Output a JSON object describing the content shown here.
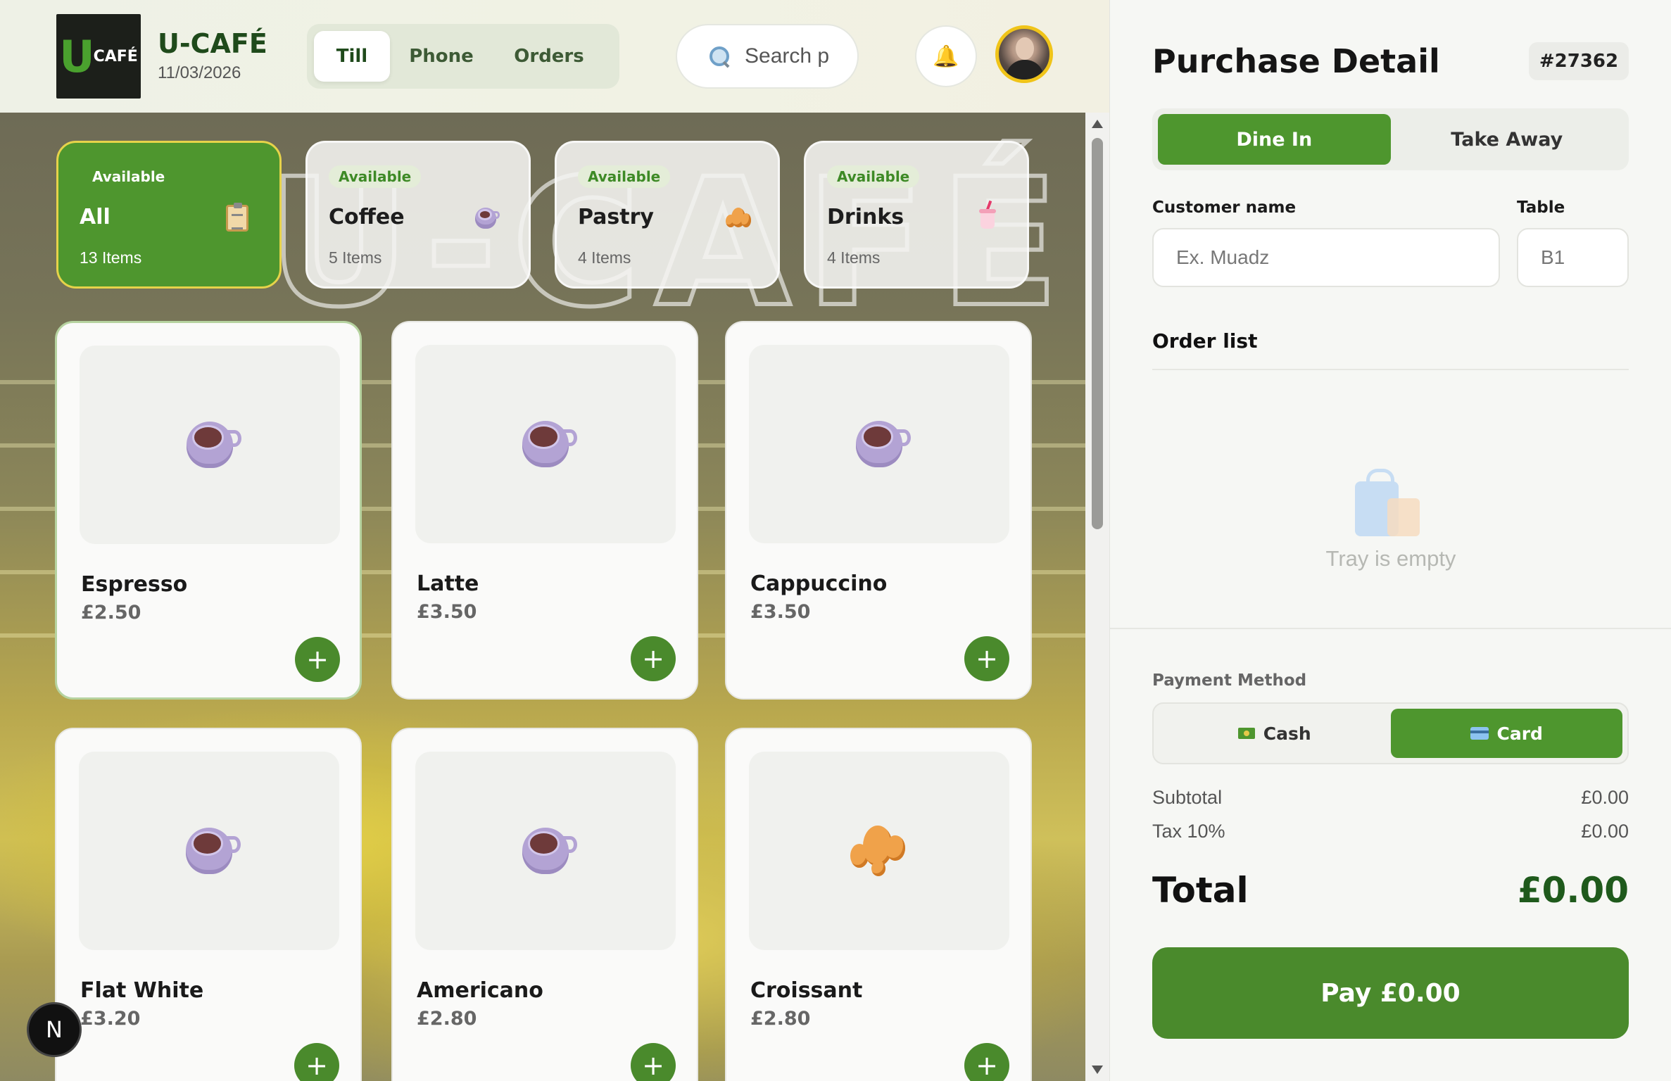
{
  "brand": {
    "logo_text_u": "U",
    "logo_text_cafe": "CAFÉ",
    "name": "U-CAFÉ",
    "date": "11/03/2026"
  },
  "nav": {
    "tabs": [
      {
        "label": "Till",
        "active": true
      },
      {
        "label": "Phone",
        "active": false
      },
      {
        "label": "Orders",
        "active": false
      }
    ]
  },
  "search": {
    "placeholder": "Search p"
  },
  "categories": [
    {
      "badge": "Available",
      "title": "All",
      "count": "13 Items",
      "icon": "clipboard-icon",
      "active": true
    },
    {
      "badge": "Available",
      "title": "Coffee",
      "count": "5 Items",
      "icon": "coffee-cup-icon",
      "active": false
    },
    {
      "badge": "Available",
      "title": "Pastry",
      "count": "4 Items",
      "icon": "croissant-icon",
      "active": false
    },
    {
      "badge": "Available",
      "title": "Drinks",
      "count": "4 Items",
      "icon": "drink-cup-icon",
      "active": false
    }
  ],
  "products": [
    {
      "name": "Espresso",
      "price": "£2.50",
      "icon": "coffee-cup-icon"
    },
    {
      "name": "Latte",
      "price": "£3.50",
      "icon": "coffee-cup-icon"
    },
    {
      "name": "Cappuccino",
      "price": "£3.50",
      "icon": "coffee-cup-icon"
    },
    {
      "name": "Flat White",
      "price": "£3.20",
      "icon": "coffee-cup-icon"
    },
    {
      "name": "Americano",
      "price": "£2.80",
      "icon": "coffee-cup-icon"
    },
    {
      "name": "Croissant",
      "price": "£2.80",
      "icon": "croissant-icon"
    }
  ],
  "add_symbol": "+",
  "dev_badge": "N",
  "purchase": {
    "title": "Purchase Detail",
    "order_number": "#27362",
    "order_types": [
      {
        "label": "Dine In",
        "active": true
      },
      {
        "label": "Take Away",
        "active": false
      }
    ],
    "customer_label": "Customer name",
    "customer_placeholder": "Ex. Muadz",
    "table_label": "Table",
    "table_placeholder": "B1",
    "order_list_title": "Order list",
    "empty_text": "Tray is empty",
    "payment_label": "Payment Method",
    "payment_methods": [
      {
        "label": "Cash",
        "icon": "cash-icon",
        "active": false
      },
      {
        "label": "Card",
        "icon": "card-icon",
        "active": true
      }
    ],
    "subtotal_label": "Subtotal",
    "subtotal_value": "£0.00",
    "tax_label": "Tax 10%",
    "tax_value": "£0.00",
    "total_label": "Total",
    "total_value": "£0.00",
    "pay_label": "Pay £0.00"
  },
  "colors": {
    "primary": "#4e962e",
    "dark_green": "#1f4a1b",
    "highlight": "#e6d34a"
  }
}
